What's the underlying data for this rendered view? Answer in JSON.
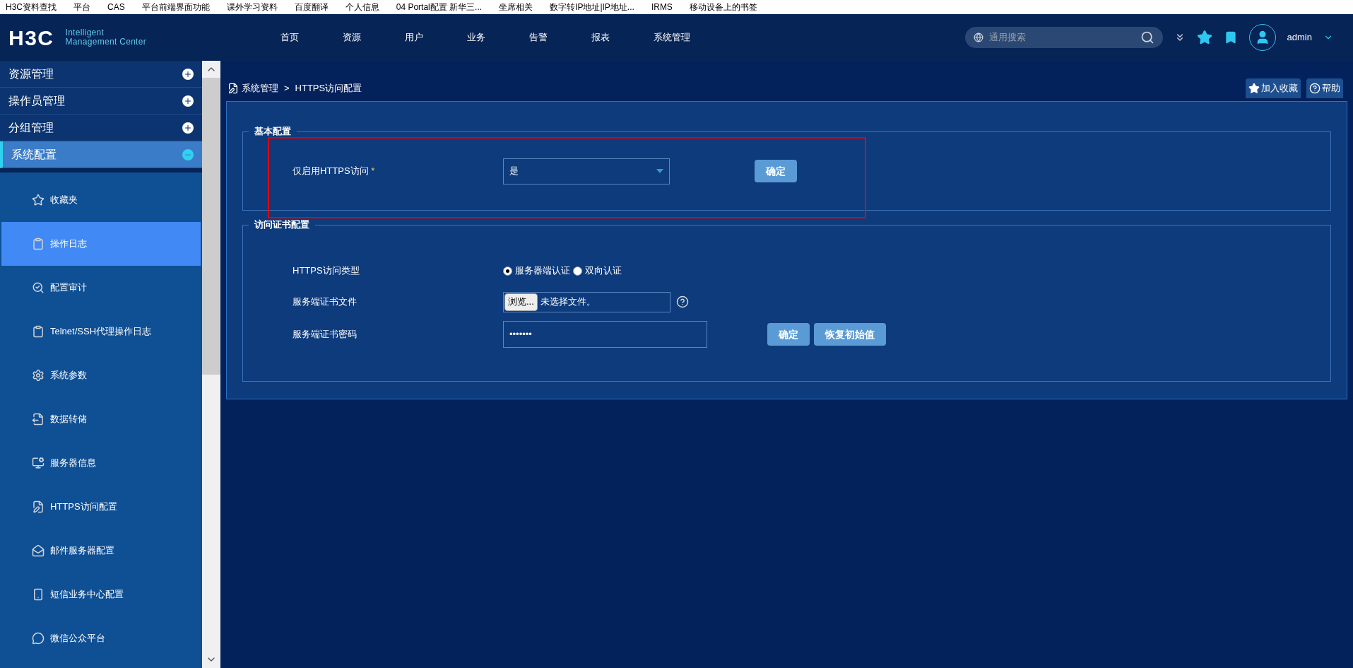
{
  "bookmarks": [
    {
      "label": "H3C资料查找"
    },
    {
      "label": "平台"
    },
    {
      "label": "CAS"
    },
    {
      "label": "平台前端界面功能"
    },
    {
      "label": "课外学习资料"
    },
    {
      "label": "百度翻译"
    },
    {
      "label": "个人信息"
    },
    {
      "label": "04 Portal配置 新华三..."
    },
    {
      "label": "坐席相关"
    },
    {
      "label": "数字转IP地址|IP地址..."
    },
    {
      "label": "IRMS"
    },
    {
      "label": "移动设备上的书签"
    }
  ],
  "header": {
    "logo": "H3C",
    "product_line1": "Intelligent",
    "product_line2": "Management Center",
    "nav": [
      {
        "label": "首页"
      },
      {
        "label": "资源"
      },
      {
        "label": "用户"
      },
      {
        "label": "业务"
      },
      {
        "label": "告警"
      },
      {
        "label": "报表"
      },
      {
        "label": "系统管理"
      }
    ],
    "search": {
      "placeholder": "通用搜索"
    },
    "user": "admin"
  },
  "sidebar": {
    "groups": [
      {
        "label": "资源管理",
        "expanded": false
      },
      {
        "label": "操作员管理",
        "expanded": false
      },
      {
        "label": "分组管理",
        "expanded": false
      },
      {
        "label": "系统配置",
        "expanded": true
      }
    ],
    "items": [
      {
        "label": "收藏夹",
        "selected": false
      },
      {
        "label": "操作日志",
        "selected": true
      },
      {
        "label": "配置审计",
        "selected": false
      },
      {
        "label": "Telnet/SSH代理操作日志",
        "selected": false
      },
      {
        "label": "系统参数",
        "selected": false
      },
      {
        "label": "数据转储",
        "selected": false
      },
      {
        "label": "服务器信息",
        "selected": false
      },
      {
        "label": "HTTPS访问配置",
        "selected": false
      },
      {
        "label": "邮件服务器配置",
        "selected": false
      },
      {
        "label": "短信业务中心配置",
        "selected": false
      },
      {
        "label": "微信公众平台",
        "selected": false
      }
    ]
  },
  "breadcrumb": {
    "parent": "系统管理",
    "separator": ">",
    "current": "HTTPS访问配置"
  },
  "actions": [
    "加入收藏",
    "帮助"
  ],
  "basic": {
    "legend": "基本配置",
    "label": "仅启用HTTPS访问",
    "required": "*",
    "value": "是",
    "button": "确定",
    "highlighted": true
  },
  "cert": {
    "legend": "访问证书配置",
    "type_label": "HTTPS访问类型",
    "radios": [
      {
        "label": "服务器端认证",
        "selected": true
      },
      {
        "label": "双向认证",
        "selected": false
      }
    ],
    "file_label": "服务端证书文件",
    "browse": "浏览...",
    "file_status": "未选择文件。",
    "password_label": "服务端证书密码",
    "password": "•••••••",
    "buttons": [
      "确定",
      "恢复初始值"
    ]
  }
}
